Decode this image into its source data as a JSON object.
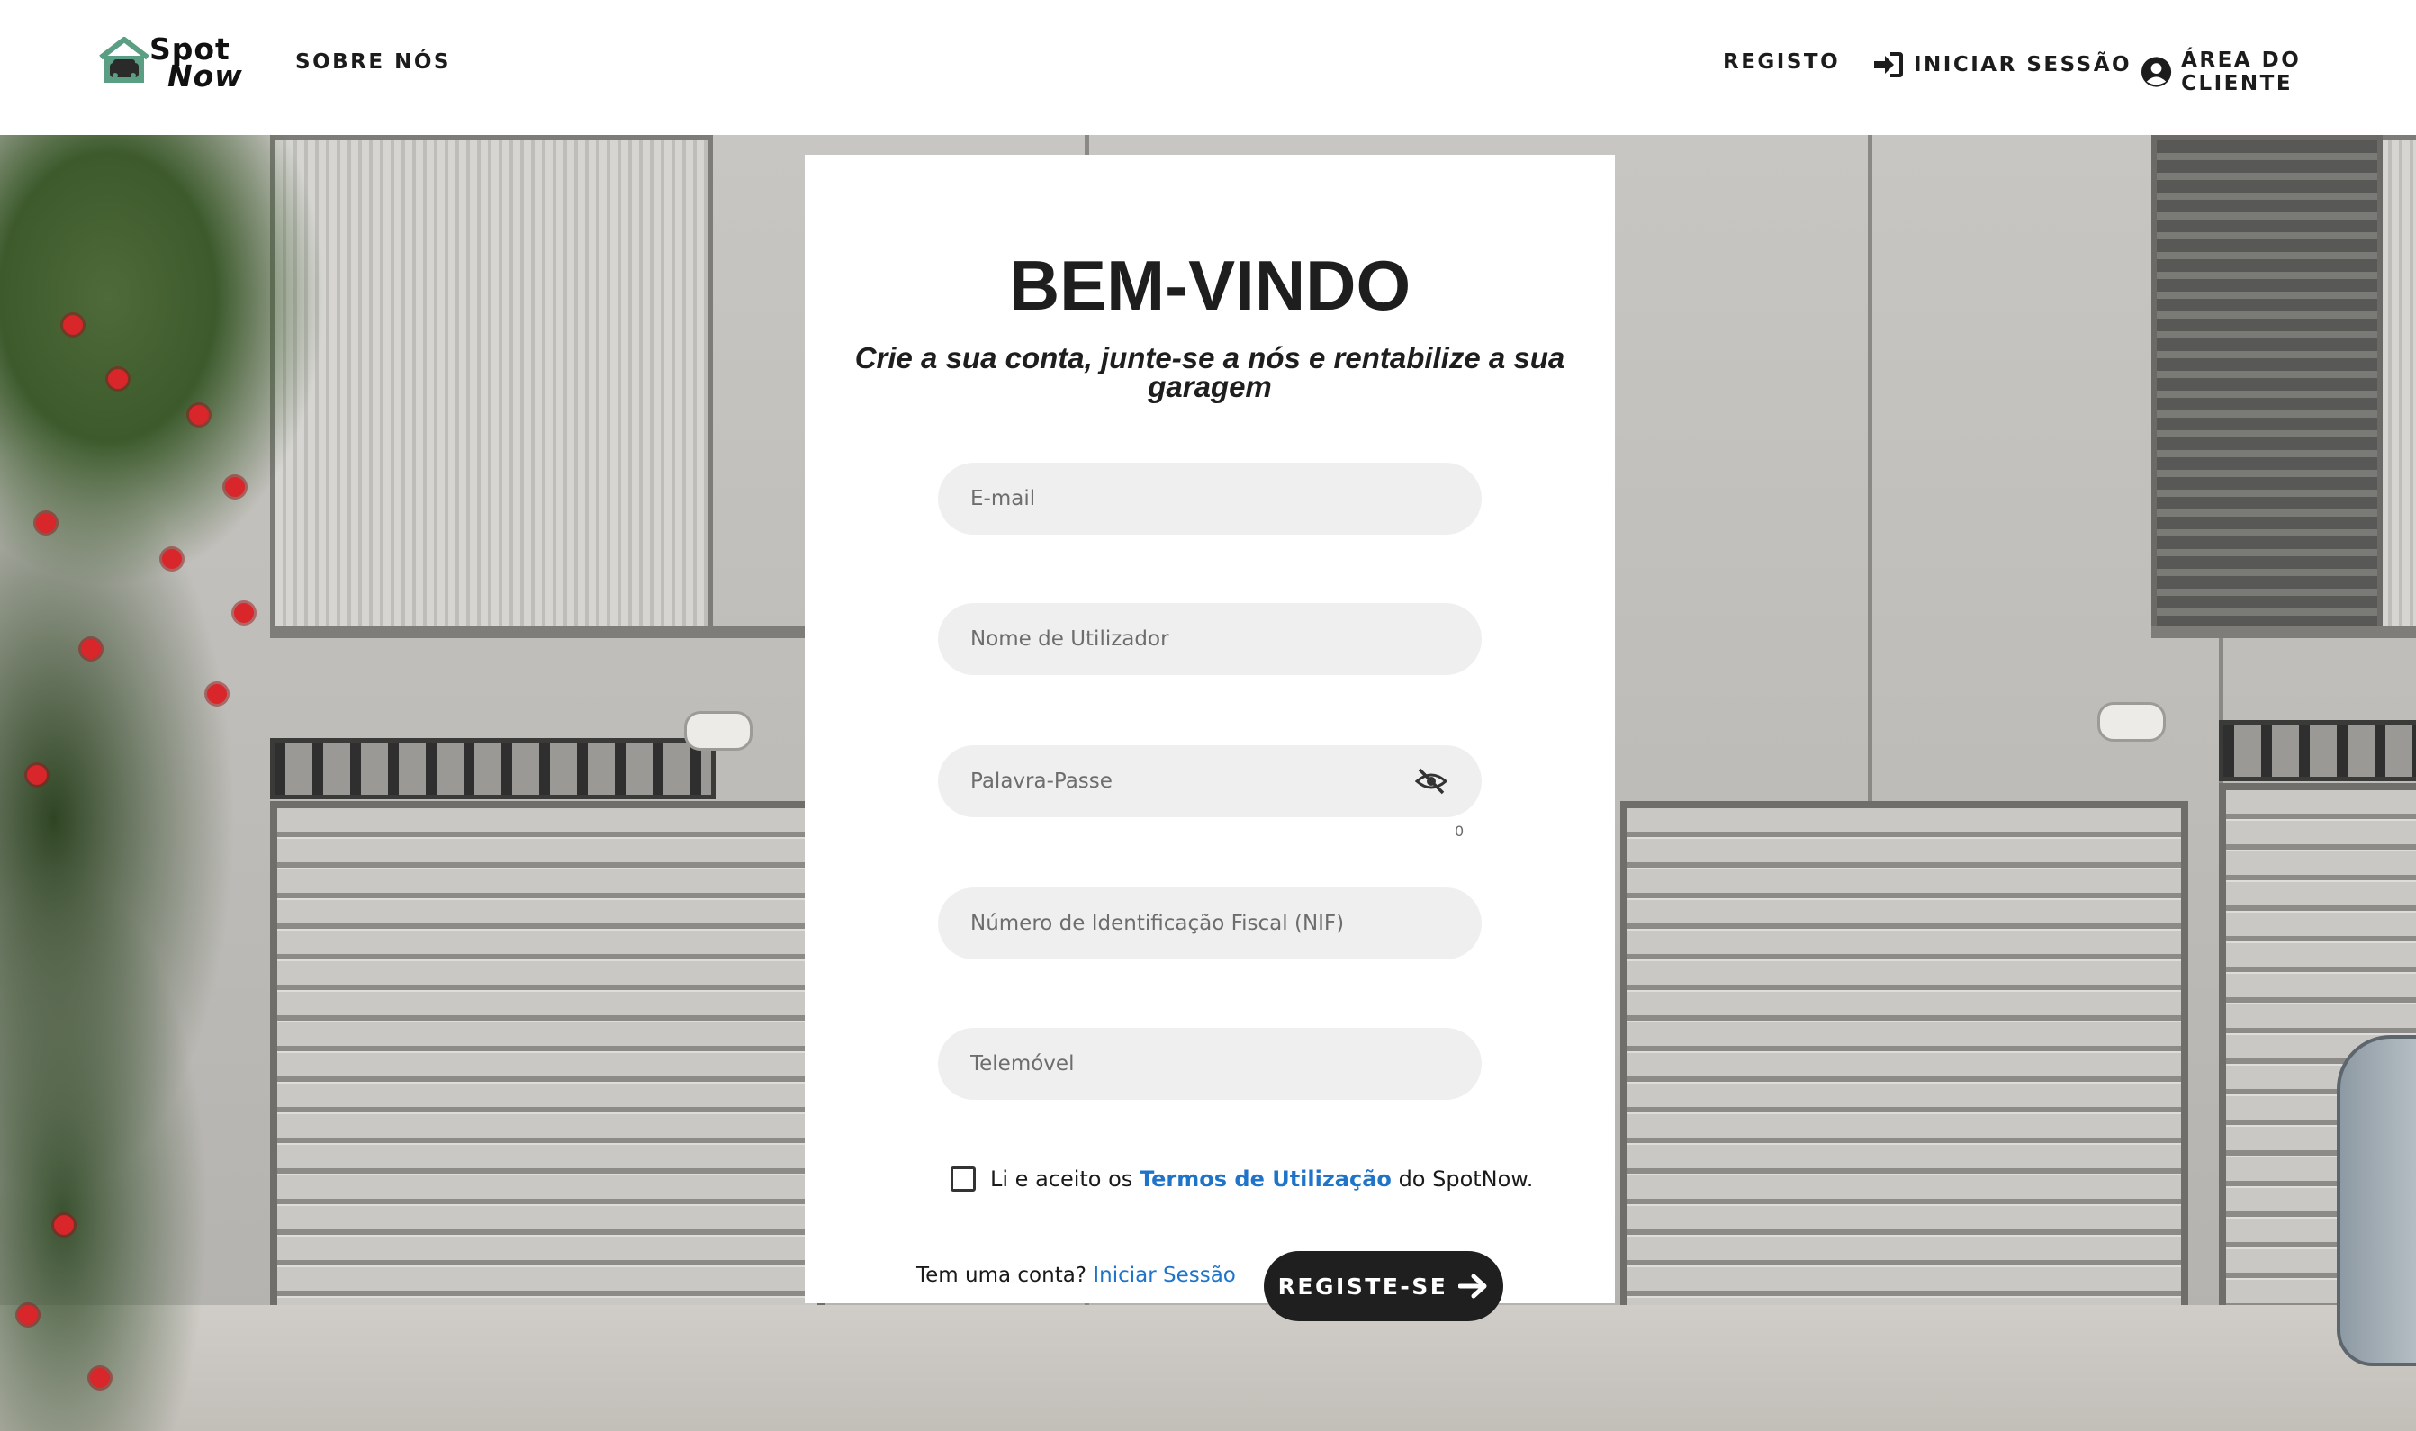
{
  "brand": {
    "name_line1": "Spot",
    "name_line2": "Now"
  },
  "nav": {
    "about": "SOBRE NÓS",
    "register": "REGISTO",
    "login": "INICIAR SESSÃO",
    "client_area": "ÁREA DO CLIENTE"
  },
  "form": {
    "title": "BEM-VINDO",
    "subtitle": "Crie a sua conta, junte-se a nós e rentabilize a sua garagem",
    "email_placeholder": "E-mail",
    "username_placeholder": "Nome de Utilizador",
    "password_placeholder": "Palavra-Passe",
    "password_counter": "0",
    "nif_placeholder": "Número de Identificação Fiscal (NIF)",
    "phone_placeholder": "Telemóvel",
    "terms_prefix": "Li e aceito os",
    "terms_link": "Termos de Utilização",
    "terms_suffix": "do SpotNow.",
    "terms_checked": false,
    "have_account": "Tem uma conta?",
    "login_link": "Iniciar Sessão",
    "submit_label": "REGISTE-SE"
  },
  "colors": {
    "accent_link": "#1f74c9",
    "button_bg": "#1f1f1f",
    "logo_green": "#5a9e84"
  },
  "icons": {
    "logo": "house-car-icon",
    "login": "sign-in-icon",
    "client": "user-circle-icon",
    "password_toggle": "eye-slash-icon",
    "submit": "arrow-right-icon"
  }
}
